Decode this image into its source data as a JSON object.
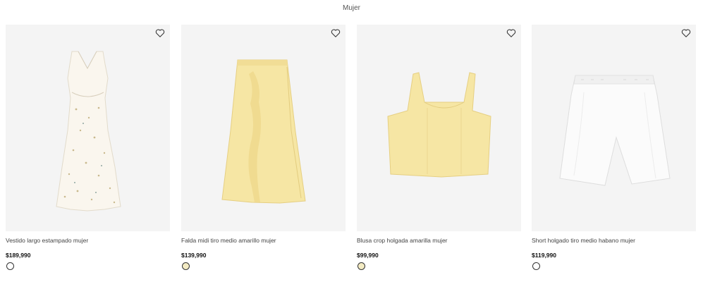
{
  "header": {
    "category": "Mujer"
  },
  "products": [
    {
      "name": "Vestido largo estampado mujer",
      "price": "$189,990",
      "swatch_color": "#ffffff",
      "favorite_icon": "heart-icon"
    },
    {
      "name": "Falda midi tiro medio amarillo mujer",
      "price": "$139,990",
      "swatch_color": "#f3ebc3",
      "favorite_icon": "heart-icon"
    },
    {
      "name": "Blusa crop holgada amarilla mujer",
      "price": "$99,990",
      "swatch_color": "#f3ebc3",
      "favorite_icon": "heart-icon"
    },
    {
      "name": "Short holgado tiro medio habano mujer",
      "price": "$119,990",
      "swatch_color": "#ffffff",
      "favorite_icon": "heart-icon"
    }
  ]
}
